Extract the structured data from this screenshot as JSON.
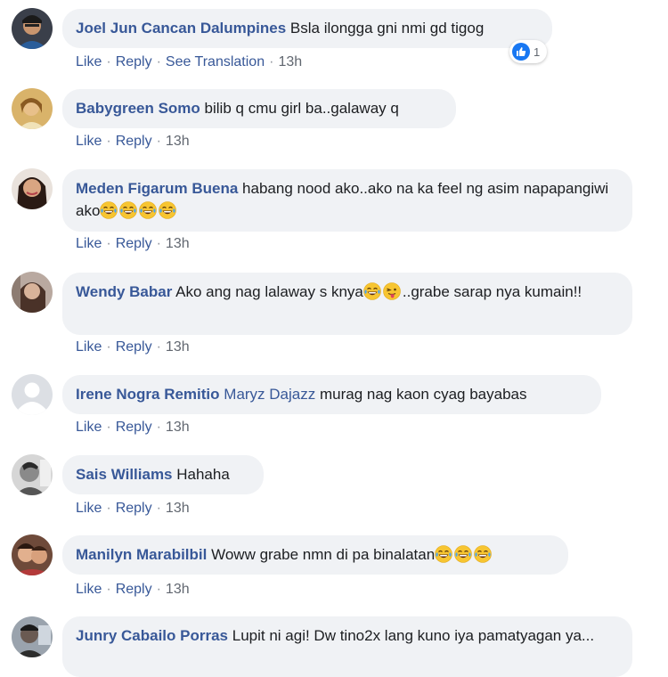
{
  "colors": {
    "author": "#385898",
    "bubble": "#f0f2f5",
    "meta": "#616770",
    "like_blue": "#1877f2"
  },
  "actions": {
    "like": "Like",
    "reply": "Reply",
    "translate": "See Translation",
    "separator": "·",
    "time": "13h"
  },
  "comments": [
    {
      "author": "Joel Jun Cancan Dalumpines",
      "text": "Bsla ilongga gni nmi gd tigog",
      "reaction_icon": "like-reaction-icon",
      "reaction_count": "1"
    },
    {
      "author": "Babygreen Somo",
      "text": "bilib q cmu girl ba..galaway q"
    },
    {
      "author": "Meden Figarum Buena",
      "text": "habang nood ako..ako na ka feel ng asim napapangiwi ako",
      "emojis": [
        "laughing-crying-emoji",
        "laughing-crying-emoji",
        "laughing-crying-emoji",
        "laughing-crying-emoji"
      ]
    },
    {
      "author": "Wendy Babar",
      "text_1": "Ako ang nag lalaway s knya",
      "text_2": "..grabe sarap nya kumain!!",
      "emojis": [
        "laughing-crying-emoji",
        "tongue-out-emoji"
      ]
    },
    {
      "author": "Irene Nogra Remitio",
      "mention": "Maryz Dajazz",
      "text": "murag nag kaon cyag bayabas"
    },
    {
      "author": "Sais Williams",
      "text": "Hahaha"
    },
    {
      "author": "Manilyn Marabilbil",
      "text": "Woww grabe nmn di pa binalatan",
      "emojis": [
        "laughing-crying-emoji",
        "laughing-crying-emoji",
        "laughing-crying-emoji"
      ]
    },
    {
      "author": "Junry Cabailo Porras",
      "text": "Lupit ni agi! Dw tino2x lang kuno iya pamatyagan ya..."
    }
  ]
}
